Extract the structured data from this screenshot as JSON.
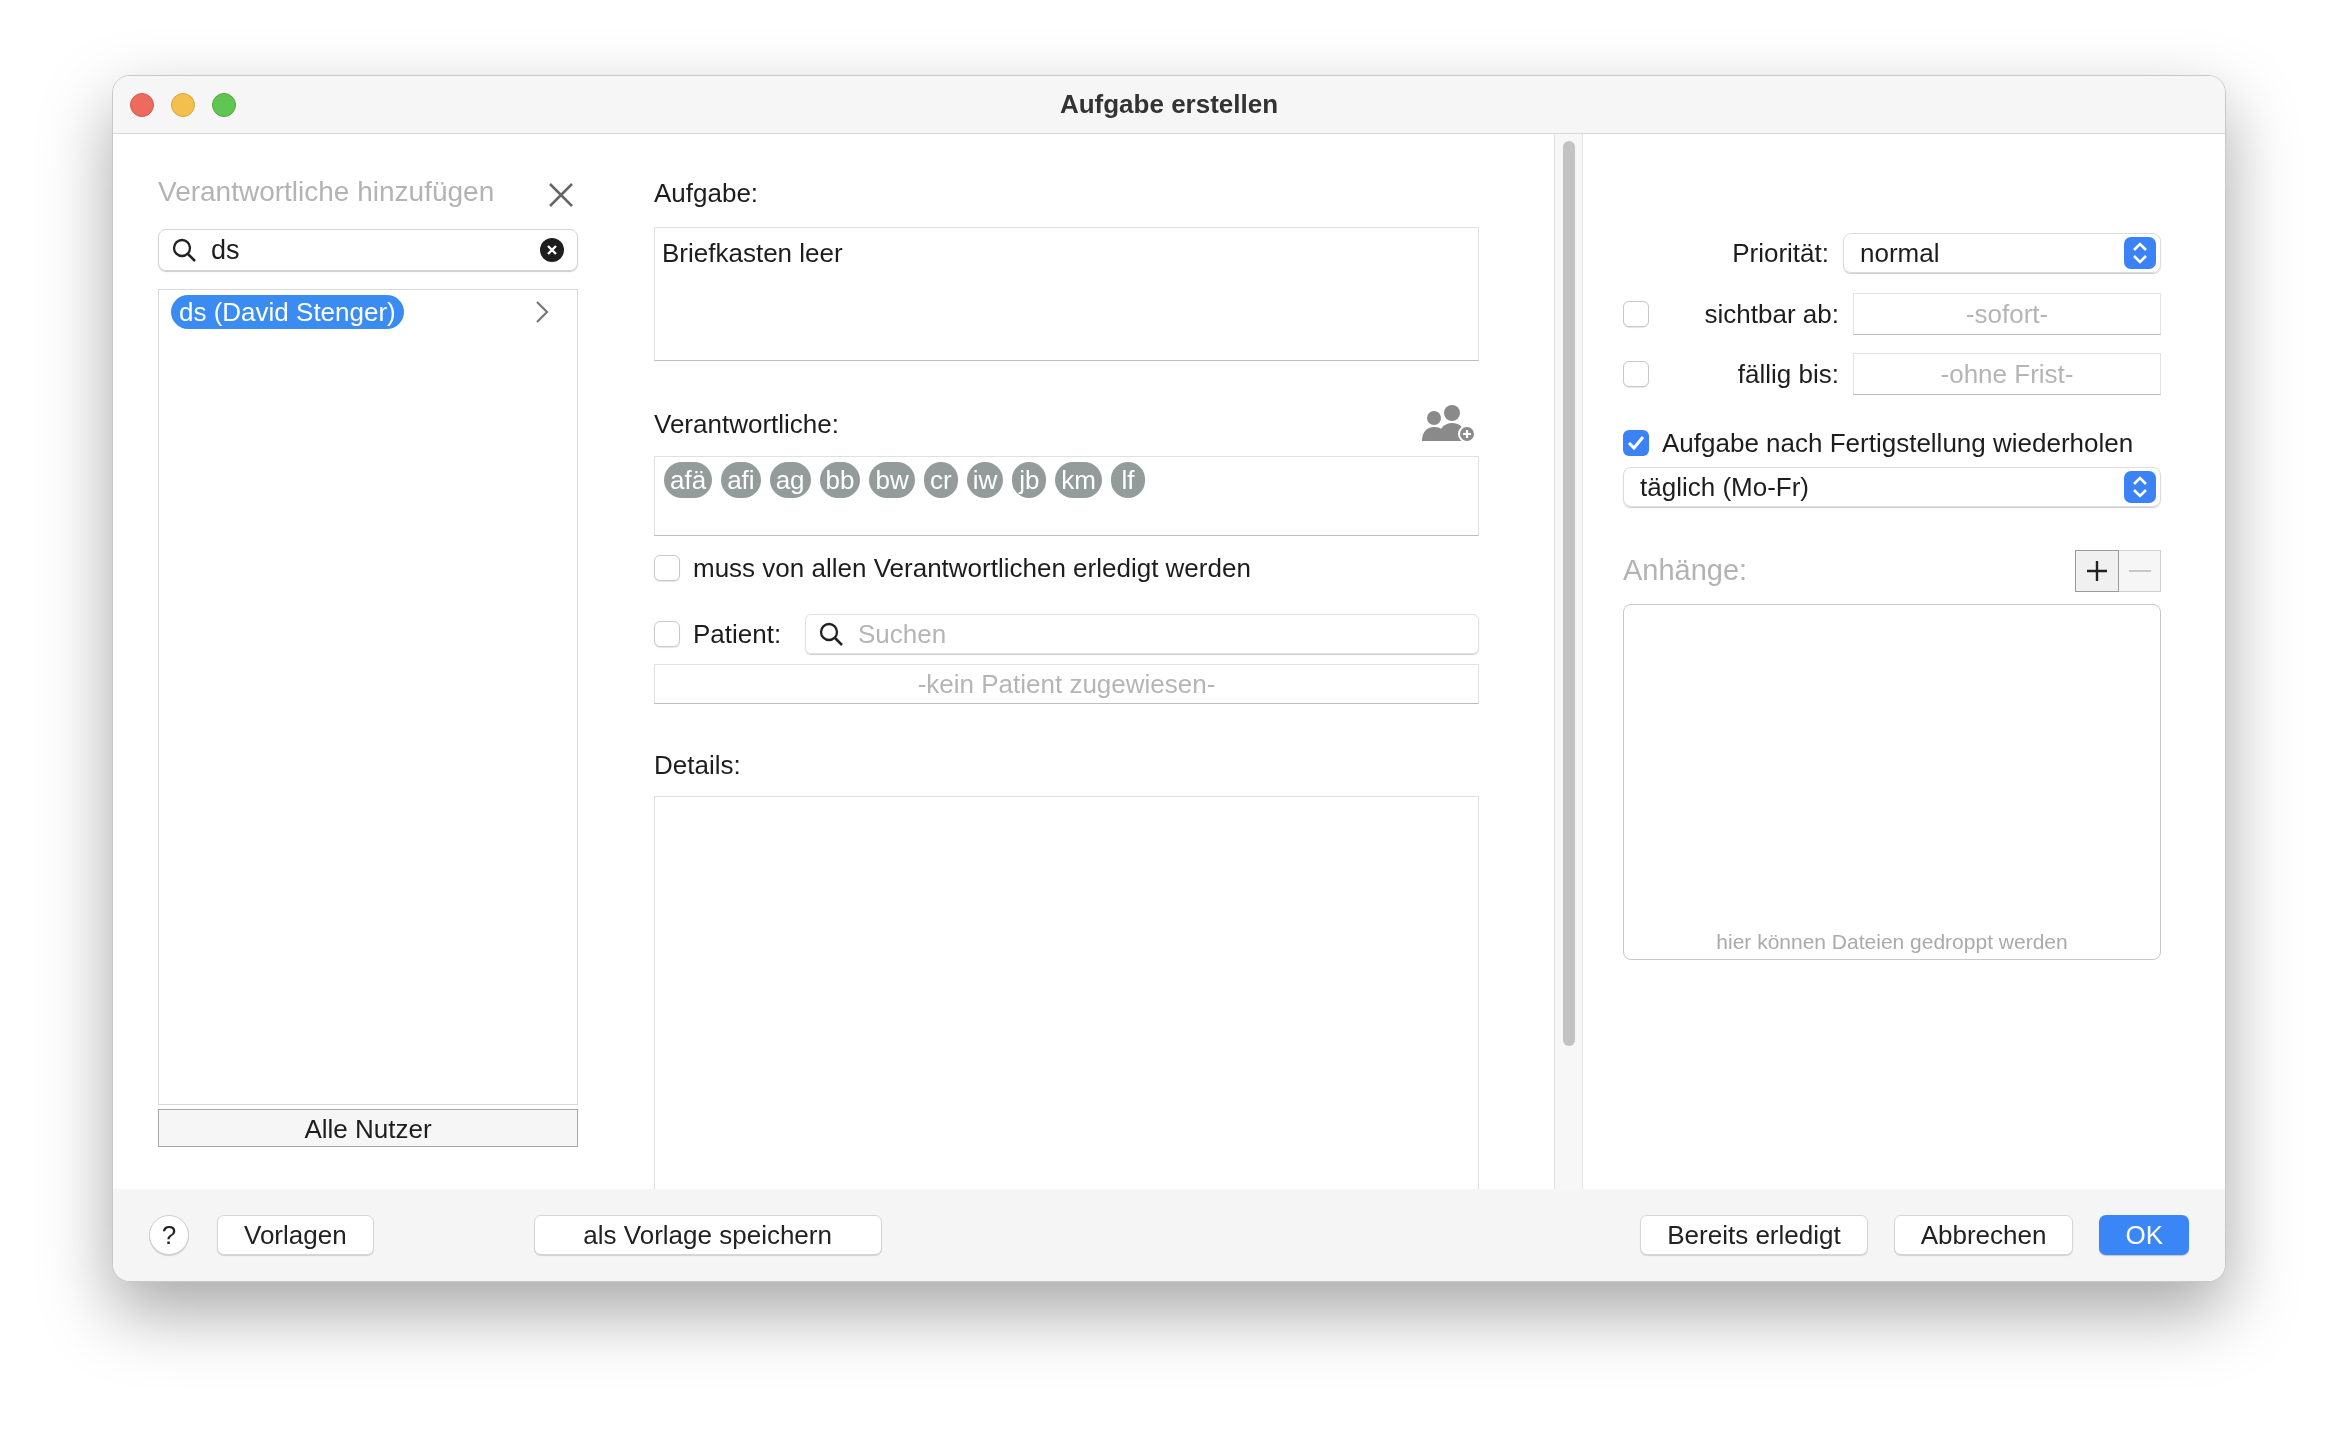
{
  "window": {
    "title": "Aufgabe erstellen"
  },
  "assignee_picker": {
    "title": "Verantwortliche hinzufügen",
    "search": {
      "value": "ds"
    },
    "results": [
      {
        "label": "ds (David Stenger)",
        "selected": true
      }
    ],
    "all_users_button": "Alle Nutzer"
  },
  "task": {
    "label": "Aufgabe:",
    "value": "Briefkasten leer"
  },
  "responsibles": {
    "label": "Verantwortliche:",
    "chips": [
      "afä",
      "afi",
      "ag",
      "bb",
      "bw",
      "cr",
      "iw",
      "jb",
      "km",
      "lf"
    ]
  },
  "all_must_complete": {
    "label": "muss von allen Verantwortlichen erledigt werden",
    "checked": false
  },
  "patient": {
    "label": "Patient:",
    "checked": false,
    "search_placeholder": "Suchen",
    "assigned": "-kein Patient zugewiesen-"
  },
  "details": {
    "label": "Details:"
  },
  "priority": {
    "label": "Priorität:",
    "value": "normal"
  },
  "visible_from": {
    "label": "sichtbar ab:",
    "checked": false,
    "placeholder": "-sofort-"
  },
  "due": {
    "label": "fällig bis:",
    "checked": false,
    "placeholder": "-ohne Frist-"
  },
  "repeat": {
    "label": "Aufgabe nach Fertigstellung wiederholen",
    "checked": true,
    "interval": "täglich (Mo-Fr)"
  },
  "attachments": {
    "label": "Anhänge:",
    "drop_hint": "hier können Dateien gedroppt werden"
  },
  "bottom_bar": {
    "left": [
      {
        "label": "?",
        "kind": "help"
      },
      {
        "label": "Vorlagen",
        "kind": "plain"
      }
    ],
    "middle": [
      {
        "label": "als Vorlage speichern",
        "kind": "plain"
      }
    ],
    "right": [
      {
        "label": "Bereits erledigt",
        "kind": "plain"
      },
      {
        "label": "Abbrechen",
        "kind": "plain"
      },
      {
        "label": "OK",
        "kind": "default"
      }
    ]
  }
}
